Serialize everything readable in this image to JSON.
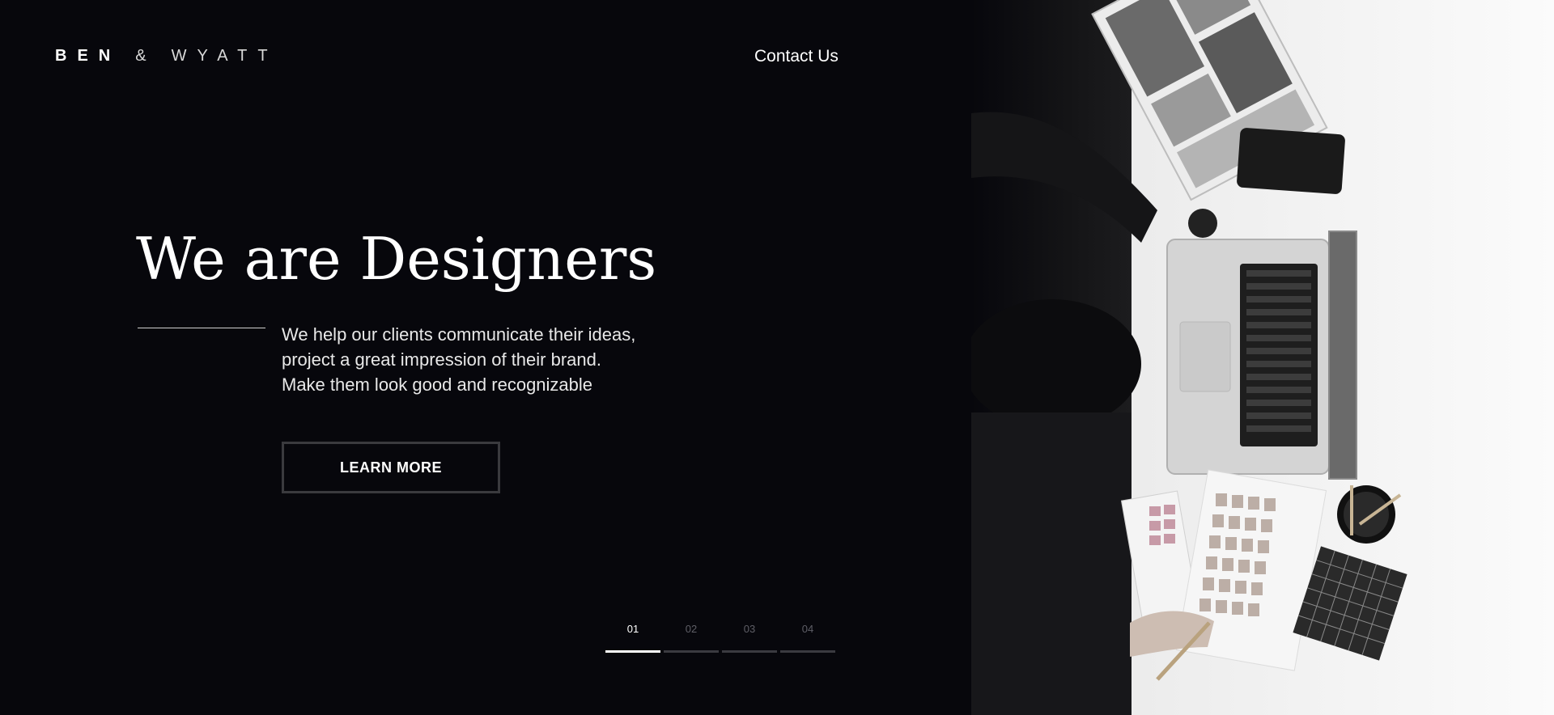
{
  "brand": {
    "word1": "BEN",
    "amp": "&",
    "word2": "WYATT"
  },
  "nav": {
    "contact_label": "Contact Us"
  },
  "hero": {
    "headline": "We are Designers",
    "description_lines": [
      "We help our clients communicate their ideas,",
      "project a great impression of their brand.",
      "Make them look good and recognizable"
    ],
    "cta_label": "LEARN MORE"
  },
  "pager": {
    "items": [
      "01",
      "02",
      "03",
      "04"
    ],
    "active_index": 0
  },
  "colors": {
    "background": "#07070c",
    "text": "#ffffff",
    "muted": "#5e5e66",
    "button_border": "#3a3a3e"
  },
  "photo": {
    "icon": "designer-at-desk-photo"
  }
}
